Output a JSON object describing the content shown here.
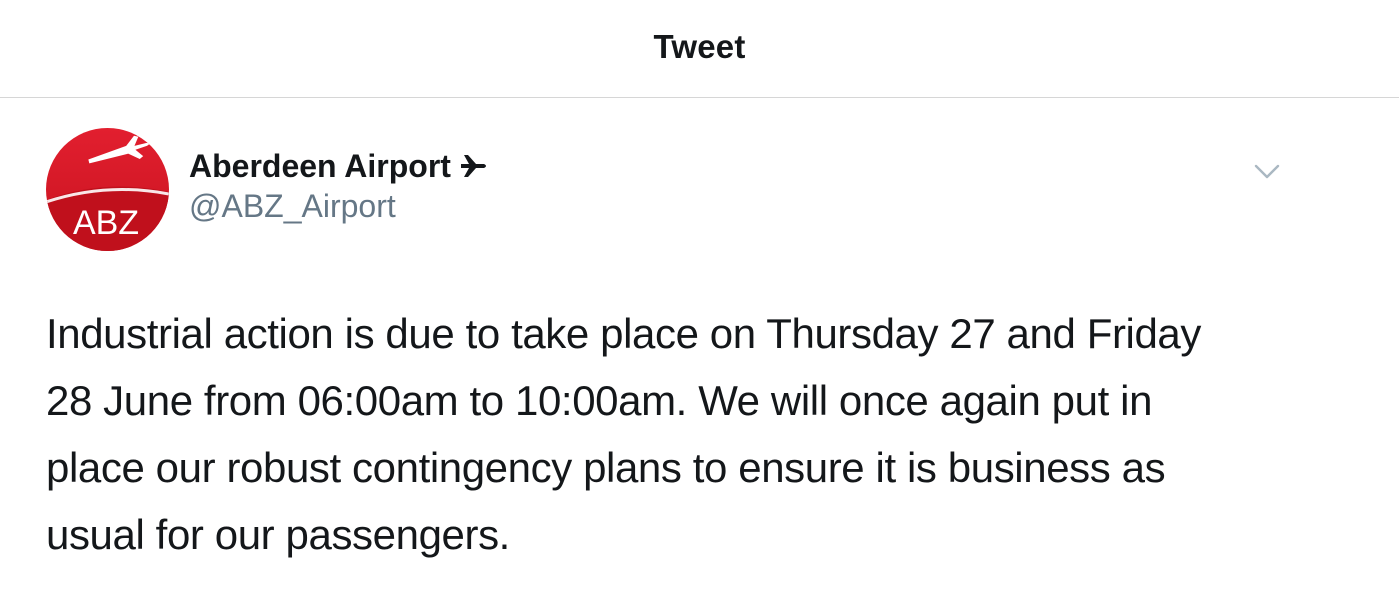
{
  "header": {
    "title": "Tweet"
  },
  "account": {
    "avatar_text": "ABZ",
    "display_name": "Aberdeen Airport",
    "name_icon": "airplane-icon",
    "handle": "@ABZ_Airport",
    "brand_color": "#d7182a"
  },
  "menu": {
    "icon": "chevron-down-icon"
  },
  "tweet": {
    "text": "Industrial action is due to take place on Thursday 27 and Friday\n28 June from 06:00am to 10:00am. We will once again put in\nplace our robust contingency plans to ensure it is business as\nusual for our passengers."
  },
  "colors": {
    "text": "#14171a",
    "secondary": "#657786",
    "divider": "#d6d6d6"
  }
}
